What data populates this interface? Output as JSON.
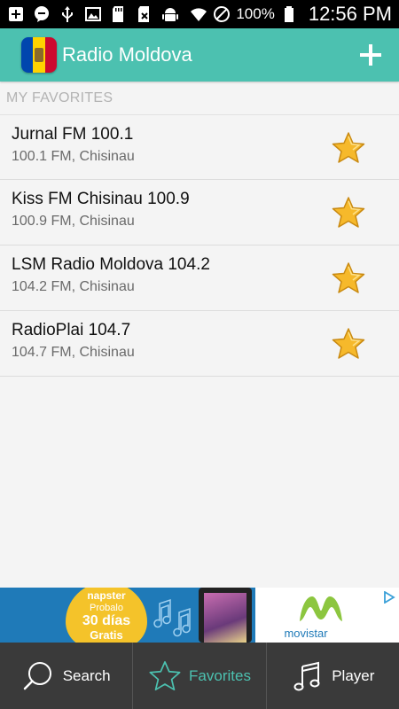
{
  "status_bar": {
    "battery_percent": "100%",
    "time": "12:56 PM",
    "icons": [
      "add-box-icon",
      "chat-bubble-icon",
      "usb-icon",
      "image-icon",
      "sd-card-icon",
      "blocked-sim-icon",
      "android-icon",
      "wifi-icon",
      "do-not-disturb-icon",
      "battery-icon"
    ]
  },
  "app_bar": {
    "title": "Radio Moldova",
    "flag_icon": "moldova-flag-icon",
    "action_icon": "add-icon"
  },
  "favorites": {
    "section_title": "MY FAVORITES",
    "stations": [
      {
        "name": "Jurnal FM 100.1",
        "subtitle": "100.1 FM, Chisinau"
      },
      {
        "name": "Kiss FM Chisinau 100.9",
        "subtitle": "100.9 FM, Chisinau"
      },
      {
        "name": "LSM Radio Moldova 104.2",
        "subtitle": "104.2 FM, Chisinau"
      },
      {
        "name": "RadioPlai 104.7",
        "subtitle": "104.7 FM, Chisinau"
      }
    ]
  },
  "ad_banner": {
    "brand": "napster",
    "line1": "Probalo",
    "line2": "30 días",
    "line3": "Gratis",
    "advertiser": "movistar"
  },
  "bottom_nav": {
    "tabs": [
      {
        "label": "Search",
        "icon": "search-icon",
        "active": false
      },
      {
        "label": "Favorites",
        "icon": "star-outline-icon",
        "active": true
      },
      {
        "label": "Player",
        "icon": "music-note-icon",
        "active": false
      }
    ]
  },
  "colors": {
    "accent": "#4cc1b0",
    "star": "#f6b92b",
    "nav_background": "#3a3a3a"
  }
}
